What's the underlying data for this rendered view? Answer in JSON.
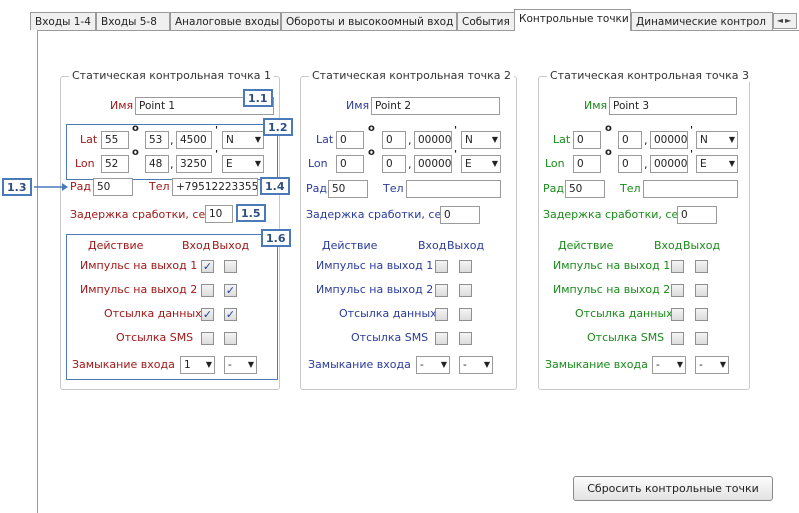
{
  "tabs": [
    {
      "label": "Входы 1-4"
    },
    {
      "label": "Входы 5-8"
    },
    {
      "label": "Аналоговые входы"
    },
    {
      "label": "Обороты и высокоомный вход"
    },
    {
      "label": "События"
    },
    {
      "label": "Контрольные точки",
      "active": true
    },
    {
      "label": "Динамические контрол"
    }
  ],
  "tab_scroll_arrows": "◄►",
  "common": {
    "name_label": "Имя",
    "lat_label": "Lat",
    "lon_label": "Lon",
    "radius_label": "Рад",
    "phone_label": "Тел",
    "delay_label": "Задержка сработки, сек",
    "action_header": "Действие",
    "input_header": "Вход",
    "output_header": "Выход",
    "action_pulse1": "Импульс на выход 1",
    "action_pulse2": "Импульс на выход 2",
    "action_data": "Отсылка данных",
    "action_sms": "Отсылка SMS",
    "input_close_label": "Замыкание входа",
    "degree_mark": "o",
    "minute_mark": "'",
    "decimal_sep": ","
  },
  "points": [
    {
      "title": "Статическая контрольная точка 1",
      "name": "Point 1",
      "lat": {
        "deg": "55",
        "min": "53",
        "frac": "4500",
        "hemi": "N"
      },
      "lon": {
        "deg": "52",
        "min": "48",
        "frac": "3250",
        "hemi": "E"
      },
      "radius": "50",
      "phone": "+79512223355",
      "delay": "10",
      "checks": {
        "pulse1_in": true,
        "pulse1_out": false,
        "pulse2_in": false,
        "pulse2_out": true,
        "data_in": true,
        "data_out": true,
        "sms_in": false,
        "sms_out": false
      },
      "input_close_1": "1",
      "input_close_2": "-"
    },
    {
      "title": "Статическая контрольная точка 2",
      "name": "Point 2",
      "lat": {
        "deg": "0",
        "min": "0",
        "frac": "00000",
        "hemi": "N"
      },
      "lon": {
        "deg": "0",
        "min": "0",
        "frac": "00000",
        "hemi": "E"
      },
      "radius": "50",
      "phone": "",
      "delay": "0",
      "checks": {
        "pulse1_in": false,
        "pulse1_out": false,
        "pulse2_in": false,
        "pulse2_out": false,
        "data_in": false,
        "data_out": false,
        "sms_in": false,
        "sms_out": false
      },
      "input_close_1": "-",
      "input_close_2": "-"
    },
    {
      "title": "Статическая контрольная точка 3",
      "name": "Point 3",
      "lat": {
        "deg": "0",
        "min": "0",
        "frac": "00000",
        "hemi": "N"
      },
      "lon": {
        "deg": "0",
        "min": "0",
        "frac": "00000",
        "hemi": "E"
      },
      "radius": "50",
      "phone": "",
      "delay": "0",
      "checks": {
        "pulse1_in": false,
        "pulse1_out": false,
        "pulse2_in": false,
        "pulse2_out": false,
        "data_in": false,
        "data_out": false,
        "sms_in": false,
        "sms_out": false
      },
      "input_close_1": "-",
      "input_close_2": "-"
    }
  ],
  "annotations": {
    "a11": "1.1",
    "a12": "1.2",
    "a13": "1.3",
    "a14": "1.4",
    "a15": "1.5",
    "a16": "1.6"
  },
  "reset_button": "Сбросить контрольные точки",
  "colors": {
    "point1_label": "#a01818",
    "point2_label": "#2a3b9c",
    "point3_label": "#1a8a1a",
    "annotation_border": "#4a7ab8"
  }
}
